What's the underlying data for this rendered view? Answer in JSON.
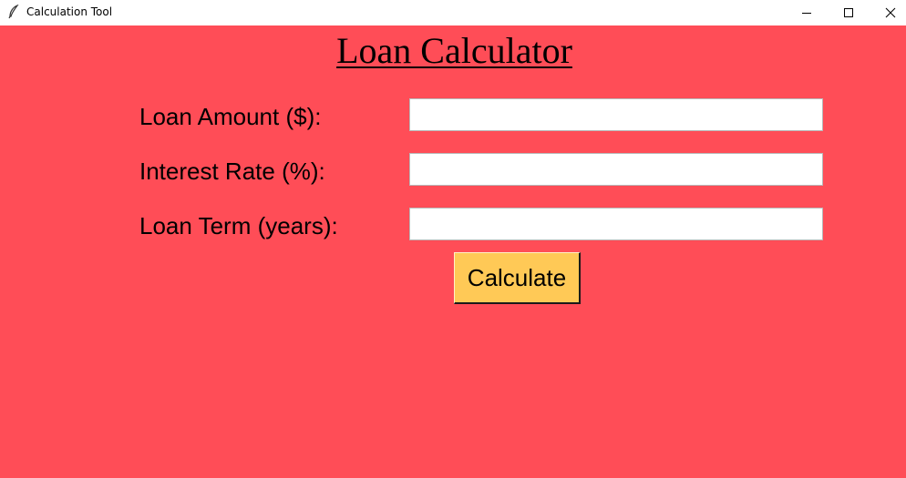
{
  "window": {
    "title": "Calculation Tool",
    "app_icon": "feather-icon",
    "controls": [
      "minimize-icon",
      "maximize-icon",
      "close-icon"
    ]
  },
  "colors": {
    "background": "#ff4d57",
    "button": "#ffc956",
    "input": "#ffffff"
  },
  "form": {
    "heading": "Loan Calculator",
    "fields": [
      {
        "label": "Loan Amount ($):",
        "value": "",
        "placeholder": ""
      },
      {
        "label": "Interest Rate (%):",
        "value": "",
        "placeholder": ""
      },
      {
        "label": "Loan Term (years):",
        "value": "",
        "placeholder": ""
      }
    ],
    "button_label": "Calculate"
  }
}
